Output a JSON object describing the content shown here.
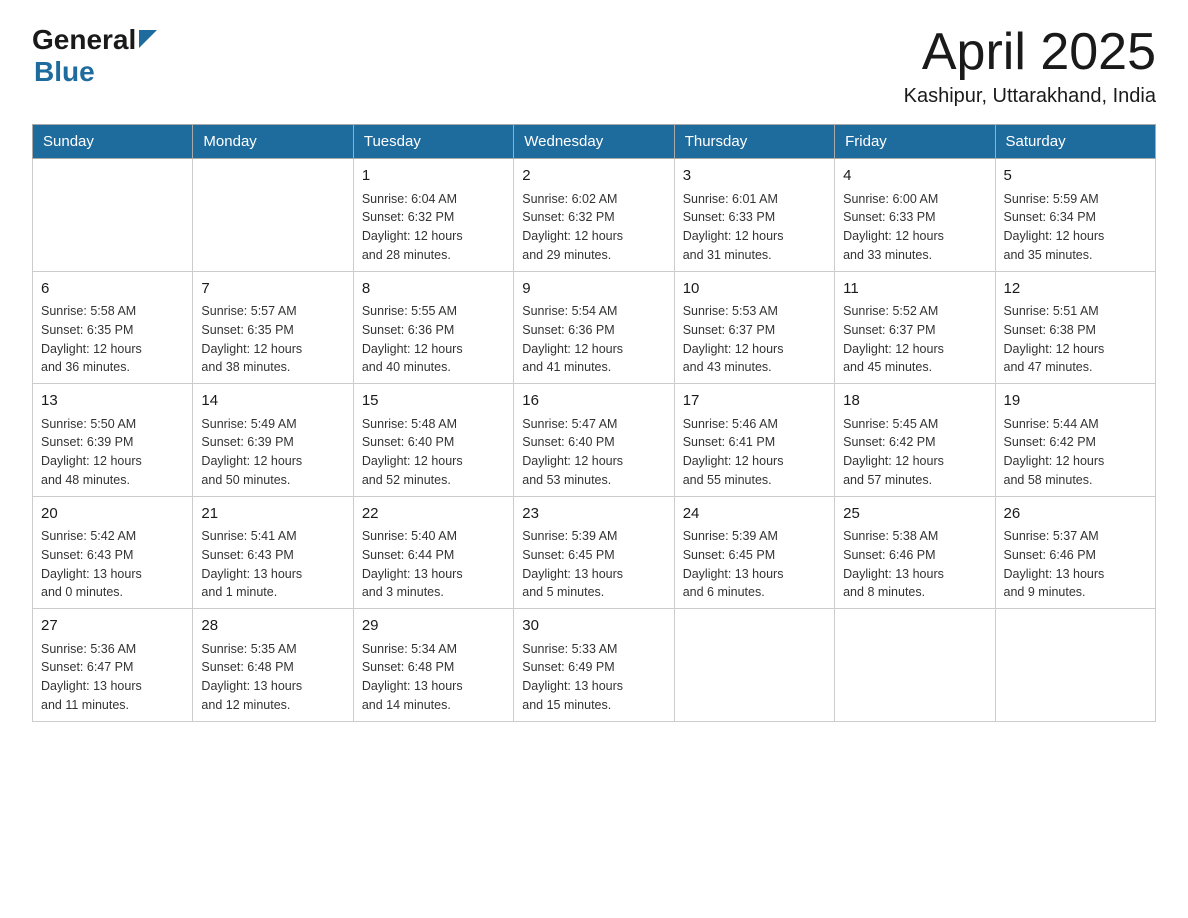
{
  "logo": {
    "general": "General",
    "blue": "Blue"
  },
  "header": {
    "month_year": "April 2025",
    "location": "Kashipur, Uttarakhand, India"
  },
  "weekdays": [
    "Sunday",
    "Monday",
    "Tuesday",
    "Wednesday",
    "Thursday",
    "Friday",
    "Saturday"
  ],
  "weeks": [
    [
      {
        "day": "",
        "info": ""
      },
      {
        "day": "",
        "info": ""
      },
      {
        "day": "1",
        "info": "Sunrise: 6:04 AM\nSunset: 6:32 PM\nDaylight: 12 hours\nand 28 minutes."
      },
      {
        "day": "2",
        "info": "Sunrise: 6:02 AM\nSunset: 6:32 PM\nDaylight: 12 hours\nand 29 minutes."
      },
      {
        "day": "3",
        "info": "Sunrise: 6:01 AM\nSunset: 6:33 PM\nDaylight: 12 hours\nand 31 minutes."
      },
      {
        "day": "4",
        "info": "Sunrise: 6:00 AM\nSunset: 6:33 PM\nDaylight: 12 hours\nand 33 minutes."
      },
      {
        "day": "5",
        "info": "Sunrise: 5:59 AM\nSunset: 6:34 PM\nDaylight: 12 hours\nand 35 minutes."
      }
    ],
    [
      {
        "day": "6",
        "info": "Sunrise: 5:58 AM\nSunset: 6:35 PM\nDaylight: 12 hours\nand 36 minutes."
      },
      {
        "day": "7",
        "info": "Sunrise: 5:57 AM\nSunset: 6:35 PM\nDaylight: 12 hours\nand 38 minutes."
      },
      {
        "day": "8",
        "info": "Sunrise: 5:55 AM\nSunset: 6:36 PM\nDaylight: 12 hours\nand 40 minutes."
      },
      {
        "day": "9",
        "info": "Sunrise: 5:54 AM\nSunset: 6:36 PM\nDaylight: 12 hours\nand 41 minutes."
      },
      {
        "day": "10",
        "info": "Sunrise: 5:53 AM\nSunset: 6:37 PM\nDaylight: 12 hours\nand 43 minutes."
      },
      {
        "day": "11",
        "info": "Sunrise: 5:52 AM\nSunset: 6:37 PM\nDaylight: 12 hours\nand 45 minutes."
      },
      {
        "day": "12",
        "info": "Sunrise: 5:51 AM\nSunset: 6:38 PM\nDaylight: 12 hours\nand 47 minutes."
      }
    ],
    [
      {
        "day": "13",
        "info": "Sunrise: 5:50 AM\nSunset: 6:39 PM\nDaylight: 12 hours\nand 48 minutes."
      },
      {
        "day": "14",
        "info": "Sunrise: 5:49 AM\nSunset: 6:39 PM\nDaylight: 12 hours\nand 50 minutes."
      },
      {
        "day": "15",
        "info": "Sunrise: 5:48 AM\nSunset: 6:40 PM\nDaylight: 12 hours\nand 52 minutes."
      },
      {
        "day": "16",
        "info": "Sunrise: 5:47 AM\nSunset: 6:40 PM\nDaylight: 12 hours\nand 53 minutes."
      },
      {
        "day": "17",
        "info": "Sunrise: 5:46 AM\nSunset: 6:41 PM\nDaylight: 12 hours\nand 55 minutes."
      },
      {
        "day": "18",
        "info": "Sunrise: 5:45 AM\nSunset: 6:42 PM\nDaylight: 12 hours\nand 57 minutes."
      },
      {
        "day": "19",
        "info": "Sunrise: 5:44 AM\nSunset: 6:42 PM\nDaylight: 12 hours\nand 58 minutes."
      }
    ],
    [
      {
        "day": "20",
        "info": "Sunrise: 5:42 AM\nSunset: 6:43 PM\nDaylight: 13 hours\nand 0 minutes."
      },
      {
        "day": "21",
        "info": "Sunrise: 5:41 AM\nSunset: 6:43 PM\nDaylight: 13 hours\nand 1 minute."
      },
      {
        "day": "22",
        "info": "Sunrise: 5:40 AM\nSunset: 6:44 PM\nDaylight: 13 hours\nand 3 minutes."
      },
      {
        "day": "23",
        "info": "Sunrise: 5:39 AM\nSunset: 6:45 PM\nDaylight: 13 hours\nand 5 minutes."
      },
      {
        "day": "24",
        "info": "Sunrise: 5:39 AM\nSunset: 6:45 PM\nDaylight: 13 hours\nand 6 minutes."
      },
      {
        "day": "25",
        "info": "Sunrise: 5:38 AM\nSunset: 6:46 PM\nDaylight: 13 hours\nand 8 minutes."
      },
      {
        "day": "26",
        "info": "Sunrise: 5:37 AM\nSunset: 6:46 PM\nDaylight: 13 hours\nand 9 minutes."
      }
    ],
    [
      {
        "day": "27",
        "info": "Sunrise: 5:36 AM\nSunset: 6:47 PM\nDaylight: 13 hours\nand 11 minutes."
      },
      {
        "day": "28",
        "info": "Sunrise: 5:35 AM\nSunset: 6:48 PM\nDaylight: 13 hours\nand 12 minutes."
      },
      {
        "day": "29",
        "info": "Sunrise: 5:34 AM\nSunset: 6:48 PM\nDaylight: 13 hours\nand 14 minutes."
      },
      {
        "day": "30",
        "info": "Sunrise: 5:33 AM\nSunset: 6:49 PM\nDaylight: 13 hours\nand 15 minutes."
      },
      {
        "day": "",
        "info": ""
      },
      {
        "day": "",
        "info": ""
      },
      {
        "day": "",
        "info": ""
      }
    ]
  ],
  "colors": {
    "header_bg": "#1e6b9e",
    "header_text": "#ffffff",
    "border": "#aaaaaa",
    "text_dark": "#1a1a1a",
    "text_info": "#333333"
  }
}
